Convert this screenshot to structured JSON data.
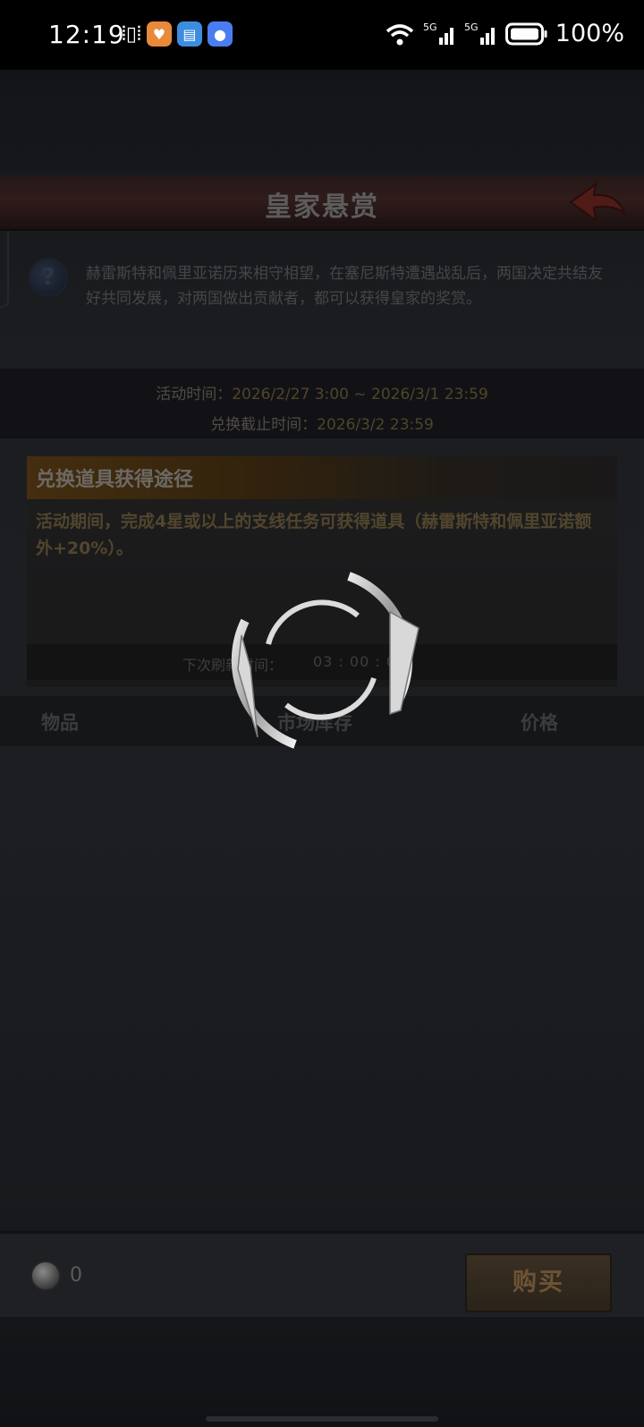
{
  "status_bar": {
    "time": "12:19",
    "battery": "100%",
    "network_1": "5G",
    "network_2": "5G",
    "wifi_sub": "6"
  },
  "header": {
    "title": "皇家悬赏"
  },
  "description": "赫雷斯特和佩里亚诺历来相守相望，在塞尼斯特遭遇战乱后，两国决定共结友好共同发展，对两国做出贡献者，都可以获得皇家的奖赏。",
  "event_time": {
    "label": "活动时间：",
    "value": "2026/2/27 3:00 ~ 2026/3/1 23:59"
  },
  "exchange_deadline": {
    "label": "兑换截止时间：",
    "value": "2026/3/2 23:59"
  },
  "acquire_panel": {
    "title": "兑换道具获得途径",
    "text": "活动期间，完成4星或以上的支线任务可获得道具（赫雷斯特和佩里亚诺额外+20%）。",
    "refresh_label": "下次刷新时间：",
    "refresh_value": "03 : 00 : 00"
  },
  "table_header": {
    "item": "物品",
    "stock": "市场库存",
    "price": "价格"
  },
  "footer": {
    "coin_count": "0",
    "buy_label": "购买"
  },
  "colors": {
    "title_bar": "#4a2b2a",
    "panel_header_accent": "#6a4718",
    "highlight_text": "#7a6a3e",
    "buy_text": "#6e5334"
  }
}
